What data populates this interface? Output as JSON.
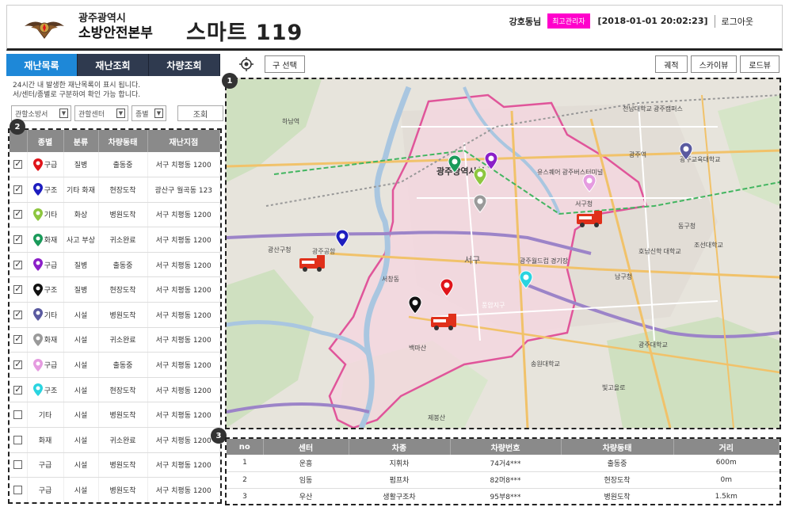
{
  "header": {
    "org_line1": "광주광역시",
    "org_line2": "소방안전본부",
    "app_title": "스마트 119",
    "user_name": "강호동님",
    "role_badge": "최고관리자",
    "datetime": "[2018-01-01 20:02:23]",
    "logout": "로그아웃"
  },
  "tabs": [
    {
      "label": "재난목록",
      "active": true
    },
    {
      "label": "재난조회",
      "active": false
    },
    {
      "label": "차량조회",
      "active": false
    }
  ],
  "description": {
    "line1": "24시간 내 발생한 재난목록이 표시 됩니다.",
    "line2": "서/센터/종별로 구분하여 확인 가능 합니다."
  },
  "filters": {
    "station": "관할소방서",
    "center": "관할센터",
    "type": "종별",
    "search_button": "조회"
  },
  "markers": {
    "m1": "1",
    "m2": "2",
    "m3": "3"
  },
  "list_table": {
    "headers": [
      "",
      "종별",
      "분류",
      "차량동태",
      "재난지점"
    ],
    "rows": [
      {
        "checked": true,
        "color": "#e0141a",
        "type": "구급",
        "category": "질병",
        "status": "출동중",
        "location": "서구 치평동 1200"
      },
      {
        "checked": true,
        "color": "#1d1dbf",
        "type": "구조",
        "category": "기타 화재",
        "status": "현장도착",
        "location": "광산구 월곡동 123"
      },
      {
        "checked": true,
        "color": "#8dc63f",
        "type": "기타",
        "category": "화상",
        "status": "병원도착",
        "location": "서구 치평동 1200"
      },
      {
        "checked": true,
        "color": "#1a9a5a",
        "type": "화재",
        "category": "사고 부상",
        "status": "귀소완료",
        "location": "서구 치평동 1200"
      },
      {
        "checked": true,
        "color": "#8b1fc8",
        "type": "구급",
        "category": "질병",
        "status": "출동중",
        "location": "서구 치평동 1200"
      },
      {
        "checked": true,
        "color": "#111111",
        "type": "구조",
        "category": "질병",
        "status": "현장도착",
        "location": "서구 치평동 1200"
      },
      {
        "checked": true,
        "color": "#5a5aa0",
        "type": "기타",
        "category": "시설",
        "status": "병원도착",
        "location": "서구 치평동 1200"
      },
      {
        "checked": true,
        "color": "#9a9a9a",
        "type": "화재",
        "category": "시설",
        "status": "귀소완료",
        "location": "서구 치평동 1200"
      },
      {
        "checked": true,
        "color": "#e59be0",
        "type": "구급",
        "category": "시설",
        "status": "출동중",
        "location": "서구 치평동 1200"
      },
      {
        "checked": true,
        "color": "#2ad4e0",
        "type": "구조",
        "category": "시설",
        "status": "현장도착",
        "location": "서구 치평동 1200"
      },
      {
        "checked": false,
        "color": "",
        "type": "기타",
        "category": "시설",
        "status": "병원도착",
        "location": "서구 치평동 1200"
      },
      {
        "checked": false,
        "color": "",
        "type": "화재",
        "category": "시설",
        "status": "귀소완료",
        "location": "서구 치평동 1200"
      },
      {
        "checked": false,
        "color": "",
        "type": "구급",
        "category": "시설",
        "status": "병원도착",
        "location": "서구 치평동 1200"
      },
      {
        "checked": false,
        "color": "",
        "type": "구급",
        "category": "시설",
        "status": "병원도착",
        "location": "서구 치평동 1200"
      }
    ]
  },
  "map_toolbar": {
    "gu_select": "구 선택",
    "view_buttons": [
      "궤적",
      "스카이뷰",
      "로드뷰"
    ]
  },
  "map_labels": {
    "gwangju_city_hall": "광주광역시청",
    "seogu": "서구",
    "gwangju_airport": "광주공항",
    "gwangsan_office": "광산구청",
    "namgu_office": "남구청",
    "donggu": "동구청",
    "baekmasan": "백마산",
    "jebongsan": "제봉산",
    "worldcup": "광주월드컵 경기장",
    "usquare": "유스퀘어 광주버스터미널",
    "seogu_office": "서구청",
    "gwangju_station": "광주역",
    "edu_office": "광주교육대학교",
    "jeonnam_univ": "전남대학교 광주캠퍼스",
    "honam_univ": "호남신학 대학교",
    "chosun_univ": "조선대학교",
    "gwangju_univ": "광주대학교",
    "songwon_univ": "송원대학교",
    "hanamsan": "하남역",
    "seochang": "서창동",
    "pungam": "풍암지구",
    "bitgoeul": "빛고을로"
  },
  "bottom_table": {
    "headers": [
      "no",
      "센터",
      "차종",
      "차량번호",
      "차량동태",
      "거리"
    ],
    "rows": [
      {
        "no": "1",
        "center": "운흥",
        "vehicle": "지휘차",
        "plate": "74거4***",
        "status": "출동중",
        "distance": "600m"
      },
      {
        "no": "2",
        "center": "임동",
        "vehicle": "펌프차",
        "plate": "82머8***",
        "status": "현장도착",
        "distance": "0m"
      },
      {
        "no": "3",
        "center": "우산",
        "vehicle": "생활구조차",
        "plate": "95부8***",
        "status": "병원도착",
        "distance": "1.5km"
      }
    ]
  }
}
